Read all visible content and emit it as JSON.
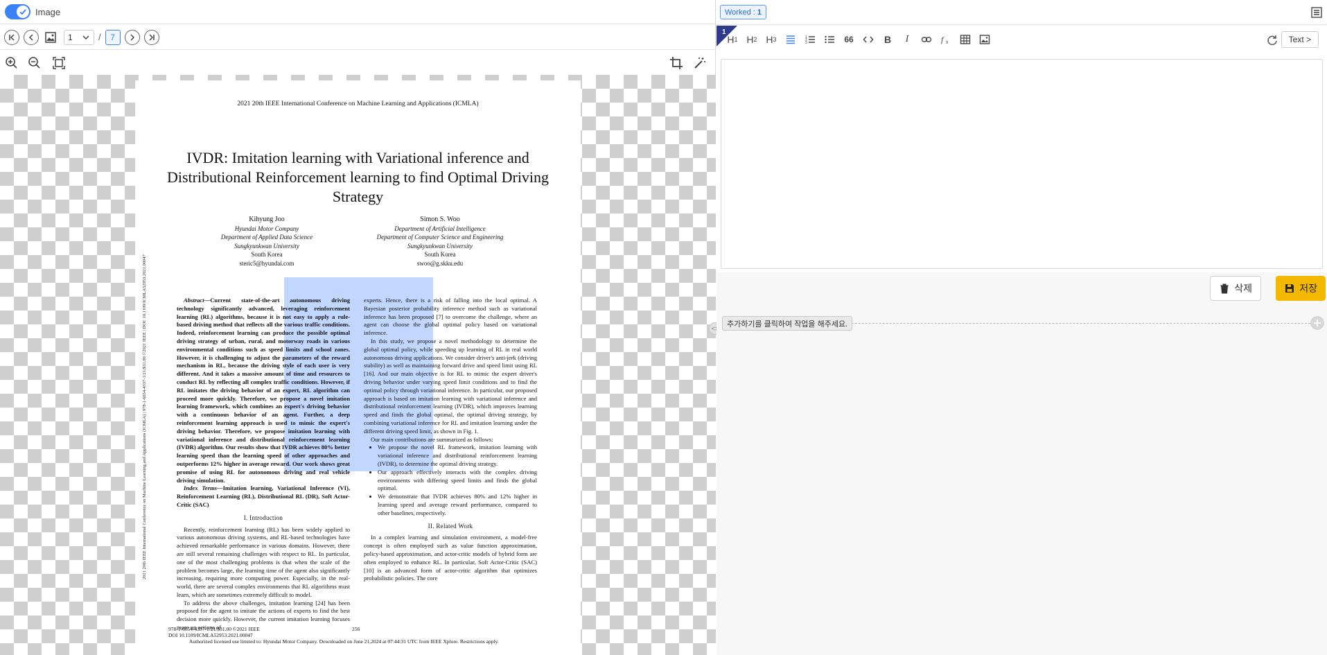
{
  "viewer": {
    "toggle_label": "Image",
    "page_current": "1",
    "page_separator": "/",
    "page_total": "7"
  },
  "paper": {
    "conference": "2021 20th IEEE International Conference on Machine Learning and Applications (ICMLA)",
    "title": "IVDR: Imitation learning with Variational inference and Distributional Reinforcement learning to find Optimal Driving Strategy",
    "author1": {
      "name": "Kihyung Joo",
      "company": "Hyundai Motor Company",
      "dept": "Department of Applied Data Science",
      "univ": "Sungkyunkwan University",
      "country": "South Korea",
      "email": "steric5@hyundai.com"
    },
    "author2": {
      "name": "Simon S. Woo",
      "dept1": "Department of Artificial Intelligence",
      "dept2": "Department of Computer Science and Engineering",
      "univ": "Sungkyunkwan University",
      "country": "South Korea",
      "email": "swoo@g.skku.edu"
    },
    "side_text": "2021 20th IEEE International Conference on Machine Learning and Applications (ICMLA) | 978-1-6654-4337-1/21/$31.00 ©2021 IEEE | DOI: 10.1109/ICMLA52953.2021.00047",
    "abstract_label": "Abstract—",
    "abstract": "Current state-of-the-art autonomous driving technology significantly advanced, leveraging reinforcement learning (RL) algorithms, because it is not easy to apply a rule-based driving method that reflects all the various traffic conditions. Indeed, reinforcement learning can produce the possible optimal driving strategy of urban, rural, and motorway roads in various environmental conditions such as speed limits and school zones. However, it is challenging to adjust the parameters of the reward mechanism in RL, because the driving style of each user is very different. And it takes a massive amount of time and resources to conduct RL by reflecting all complex traffic conditions. However, if RL imitates the driving behavior of an expert, RL algorithm can proceed more quickly. Therefore, we propose a novel imitation learning framework, which combines an expert's driving behavior with a continuous behavior of an agent. Further, a deep reinforcement learning approach is used to mimic the expert's driving behavior. Therefore, we propose imitation learning with variational inference and distributional reinforcement learning (IVDR) algorithm. Our results show that IVDR achieves 80% better learning speed than the learning speed of other approaches and outperforms 12% higher in average reward. Our work shows great promise of using RL for autonomous driving and real vehicle driving simulation.",
    "index_label": "Index Terms—",
    "index_terms": "Imitation learning, Variational Inference (VI), Reinforcement Learning (RL), Distributional RL (DR), Soft Actor-Critic (SAC)",
    "sec1": "I. Introduction",
    "intro_p1": "Recently, reinforcement learning (RL) has been widely applied to various autonomous driving systems, and RL-based technologies have achieved remarkable performance in various domains. However, there are still several remaining challenges with respect to RL. In particular, one of the most challenging problems is that when the scale of the problem becomes large, the learning time of the agent also significantly increasing, requiring more computing power. Especially, in the real-world, there are several complex environments that RL algorithms must learn, which are sometimes extremely difficult to model.",
    "intro_p2": "To address the above challenges, imitation learning [24] has been proposed for the agent to imitate the actions of experts to find the best decision more quickly. However, the current imitation learning focuses more on actions of",
    "right_p1": "experts. Hence, there is a risk of falling into the local optimal. A Bayesian posterior probability inference method such as variational inference has been proposed [7] to overcome the challenge, where an agent can choose the global optimal policy based on variational inference.",
    "right_p2": "In this study, we propose a novel methodology to determine the global optimal policy, while speeding up learning of RL in real world autonomous driving applications. We consider driver's anti-jerk (driving stability) as well as maintaining forward drive and speed limit using RL [16]. And our main objective is for RL to mimic the expert driver's driving behavior under varying speed limit conditions and to find the optimal policy through variational inference. In particular, our proposed approach is based on imitation learning with variational inference and distributional reinforcement learning (IVDR), which improves learning speed and finds the global optimal, the optimal driving strategy, by combining variational inference for RL and imitation learning under the different driving speed limit, as shown in Fig. 1.",
    "right_p3": "Our main contributions are summarized as follows:",
    "bullets": [
      "We propose the novel RL framework, imitation learning with variational inference and distributional reinforcement learning (IVDR), to determine the optimal driving strategy.",
      "Our approach effectively interacts with the complex driving environments with differing speed limits and finds the global optimal.",
      "We demonstrate that IVDR achieves 80% and 12% higher in learning speed and average reward performance, compared to other baselines, respectively."
    ],
    "sec2": "II. Related Work",
    "related_p1": "In a complex learning and simulation environment, a model-free concept is often employed such as value function approximation, policy-based approximation, and actor-critic models of hybrid form are often employed to enhance RL. In particular, Soft Actor-Critic (SAC) [10] is an advanced form of actor-critic algorithm that optimizes probabilistic policies. The core",
    "footer_left1": "978-1-6654-4337-1/21/$31.00 ©2021 IEEE",
    "footer_left2": "DOI 10.1109/ICMLA52953.2021.00047",
    "page_number": "256",
    "footer_dl": "Authorized licensed use limited to: Hyundai Motor Company. Downloaded on June 21,2024 at 07:44:31 UTC from IEEE Xplore.  Restrictions apply."
  },
  "right_panel": {
    "worked_label": "Worked :",
    "worked_count": "1",
    "card_number": "1",
    "toolbar": {
      "h1": "H",
      "h2": "H",
      "h3": "H",
      "quote": "66",
      "bold": "B",
      "italic": "I",
      "text_button": "Text >"
    },
    "delete_label": "삭제",
    "save_label": "저장",
    "hint": "추가하기를 클릭하여 작업을 해주세요.",
    "colors": {
      "accent": "#3b82f6",
      "save": "#f5b800",
      "card_corner": "#2f3a8c"
    }
  },
  "icons": [
    "check-icon",
    "first-page-icon",
    "prev-page-icon",
    "image-icon",
    "chevron-down-icon",
    "next-page-icon",
    "last-page-icon",
    "zoom-in-icon",
    "zoom-out-icon",
    "fit-screen-icon",
    "crop-icon",
    "magic-wand-icon",
    "list-icon",
    "align-icon",
    "ordered-list-icon",
    "bullet-list-icon",
    "code-icon",
    "link-icon",
    "formula-icon",
    "table-icon",
    "insert-image-icon",
    "refresh-icon",
    "trash-icon",
    "save-icon",
    "plus-icon"
  ]
}
